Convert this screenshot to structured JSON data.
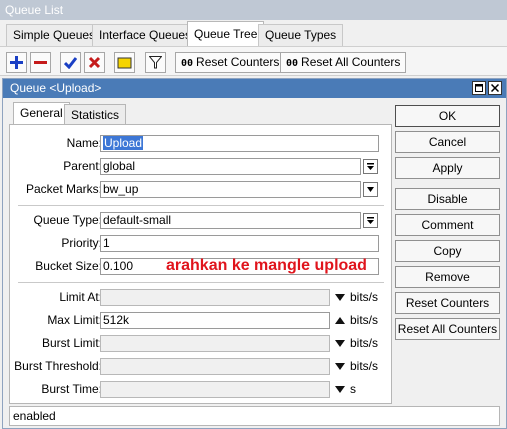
{
  "window_title": "Queue List",
  "tabs": [
    "Simple Queues",
    "Interface Queues",
    "Queue Tree",
    "Queue Types"
  ],
  "toolbar": {
    "reset_counters_label": "Reset Counters",
    "reset_all_counters_label": "Reset All Counters",
    "counter_badge": "00",
    "icons": [
      "add-icon",
      "remove-icon",
      "enable-icon",
      "disable-icon",
      "comment-icon",
      "filter-icon"
    ],
    "colors": {
      "add": "#1a3fc4",
      "remove": "#c51b1b",
      "enable": "#1a3fc4",
      "disable": "#c51b1b"
    }
  },
  "dialog": {
    "title": "Queue <Upload>",
    "tabs": [
      "General",
      "Statistics"
    ],
    "fields": {
      "name": {
        "label": "Name:",
        "value": "Upload"
      },
      "parent": {
        "label": "Parent:",
        "value": "global"
      },
      "packet_marks": {
        "label": "Packet Marks:",
        "value": "bw_up"
      },
      "queue_type": {
        "label": "Queue Type:",
        "value": "default-small"
      },
      "priority": {
        "label": "Priority:",
        "value": "1"
      },
      "bucket_size": {
        "label": "Bucket Size:",
        "value": "0.100"
      },
      "limit_at": {
        "label": "Limit At:",
        "value": "",
        "unit": "bits/s"
      },
      "max_limit": {
        "label": "Max Limit:",
        "value": "512k",
        "unit": "bits/s"
      },
      "burst_limit": {
        "label": "Burst Limit:",
        "value": "",
        "unit": "bits/s"
      },
      "burst_threshold": {
        "label": "Burst Threshold:",
        "value": "",
        "unit": "bits/s"
      },
      "burst_time": {
        "label": "Burst Time:",
        "value": "",
        "unit": "s"
      }
    },
    "buttons": [
      "OK",
      "Cancel",
      "Apply",
      "Disable",
      "Comment",
      "Copy",
      "Remove",
      "Reset Counters",
      "Reset All Counters"
    ],
    "status": "enabled",
    "annotation": "arahkan ke mangle upload",
    "annotation_color": "#e0141c",
    "title_bar_color": "#4a7bb7"
  }
}
